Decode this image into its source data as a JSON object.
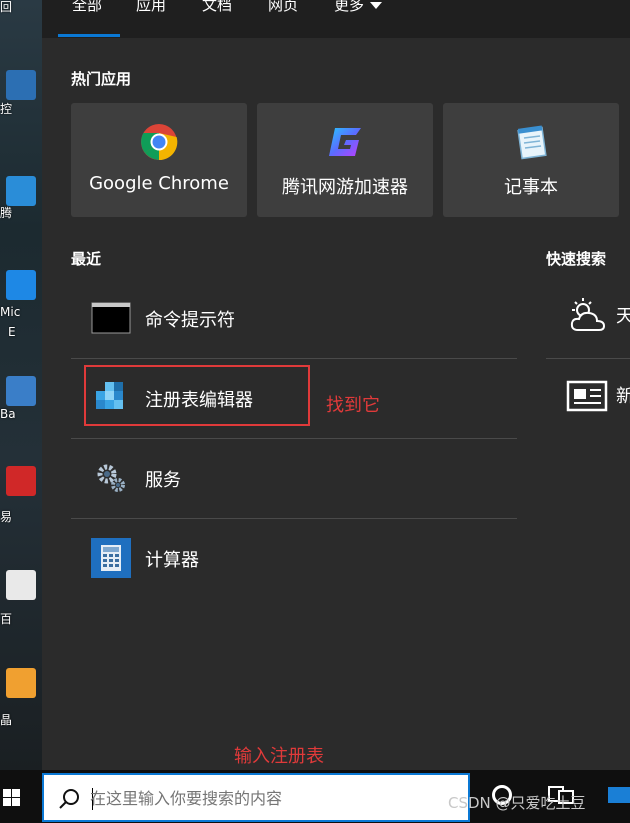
{
  "tabs": [
    {
      "label": "全部"
    },
    {
      "label": "应用"
    },
    {
      "label": "文档"
    },
    {
      "label": "网页"
    },
    {
      "label": "更多"
    }
  ],
  "popular": {
    "title": "热门应用",
    "apps": [
      {
        "label": "Google Chrome",
        "icon": "chrome-icon"
      },
      {
        "label": "腾讯网游加速器",
        "icon": "tencent-accelerator-icon"
      },
      {
        "label": "记事本",
        "icon": "notepad-icon"
      }
    ]
  },
  "recent": {
    "title": "最近",
    "items": [
      {
        "label": "命令提示符",
        "icon": "cmd-icon"
      },
      {
        "label": "注册表编辑器",
        "icon": "regedit-icon"
      },
      {
        "label": "服务",
        "icon": "services-gear-icon"
      },
      {
        "label": "计算器",
        "icon": "calculator-icon"
      }
    ]
  },
  "quick_search": {
    "title": "快速搜索",
    "items": [
      {
        "label": "天",
        "icon": "weather-icon"
      },
      {
        "label": "新",
        "icon": "news-icon"
      }
    ]
  },
  "annotations": {
    "find_it": "找到它",
    "type_regedit": "输入注册表"
  },
  "desktop_labels": [
    "回",
    "控",
    "腾",
    "Mic",
    "E",
    "Ba",
    "易",
    "百",
    "晶"
  ],
  "taskbar": {
    "search_placeholder": "在这里输入你要搜索的内容",
    "watermark": "CSDN @只爱吃土豆"
  },
  "colors": {
    "accent": "#0a78d4",
    "annotation": "#e03a3a",
    "panel_bg": "#2b2b2b"
  }
}
